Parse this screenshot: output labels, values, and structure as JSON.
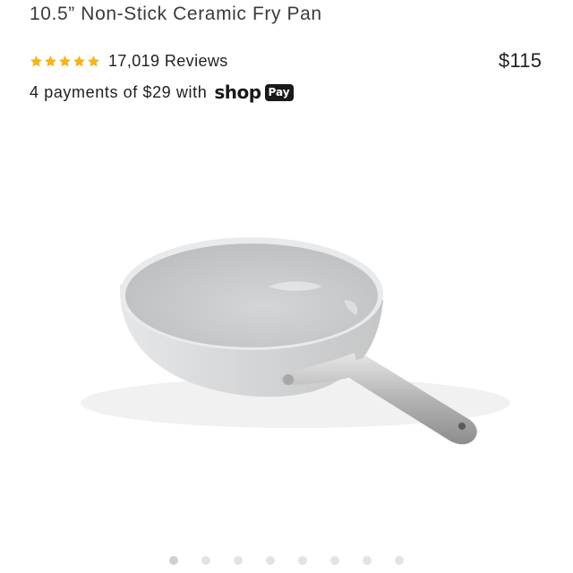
{
  "product": {
    "title": "10.5” Non-Stick Ceramic Fry Pan",
    "rating_stars": 5,
    "reviews_label": "17,019 Reviews",
    "price": "$115",
    "payments_text": "4 payments of $29 with",
    "shop_logo_text": "shop",
    "shop_pay_badge": "Pay",
    "image_icon": "frying-pan-image",
    "carousel": {
      "total": 8,
      "active_index": 0
    }
  },
  "colors": {
    "star": "#f4b41a",
    "pan_exterior": "#d6d8da",
    "pan_interior": "#c9ccce",
    "handle": "#bfbfbf"
  }
}
